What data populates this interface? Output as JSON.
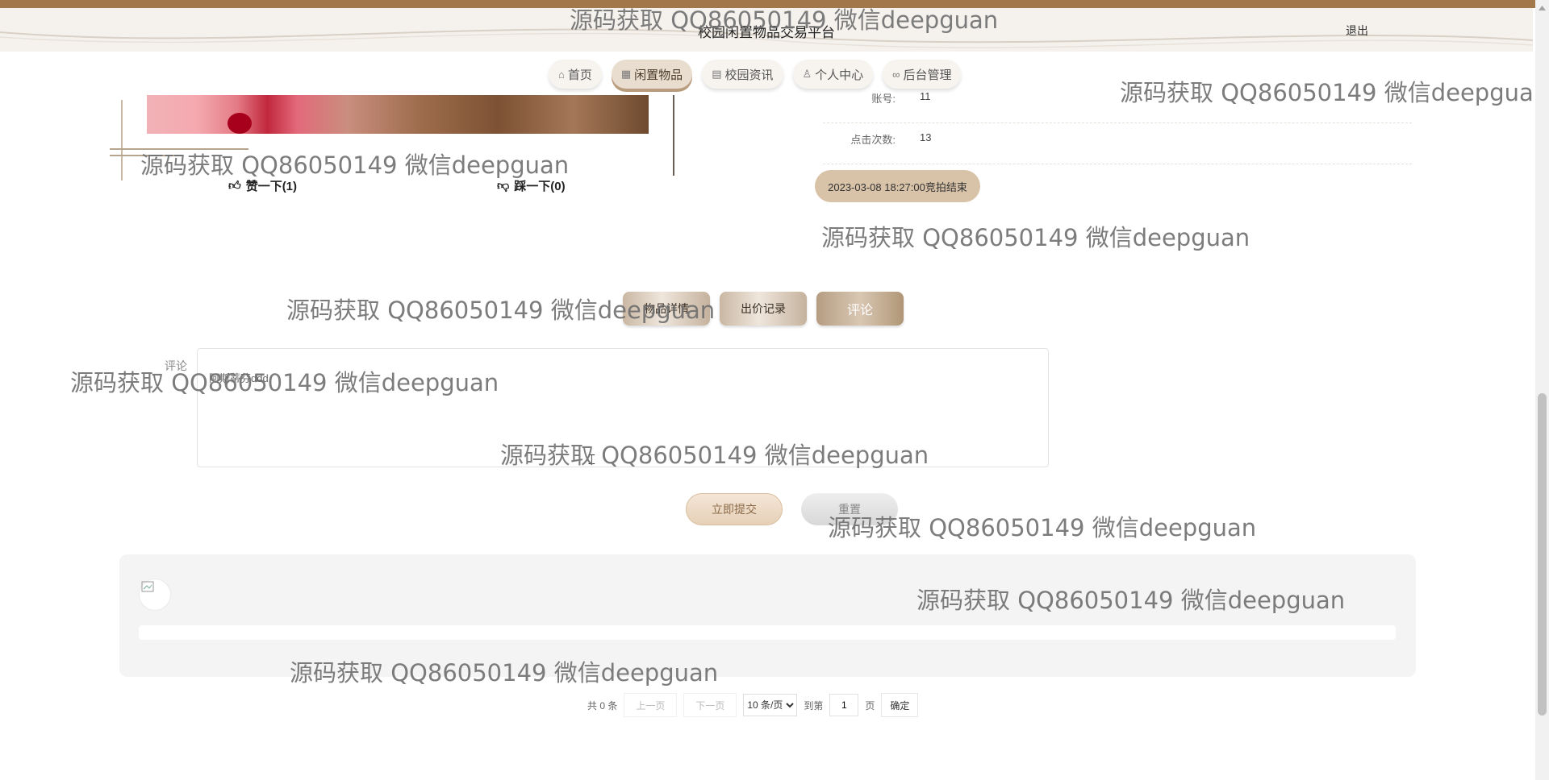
{
  "header": {
    "site_title": "校园闲置物品交易平台",
    "logout": "退出"
  },
  "nav": [
    {
      "label": "首页",
      "icon": "home-icon",
      "glyph": "⌂"
    },
    {
      "label": "闲置物品",
      "icon": "gift-icon",
      "glyph": "▦"
    },
    {
      "label": "校园资讯",
      "icon": "news-icon",
      "glyph": "▤"
    },
    {
      "label": "个人中心",
      "icon": "user-icon",
      "glyph": "♙"
    },
    {
      "label": "后台管理",
      "icon": "link-icon",
      "glyph": "∞"
    }
  ],
  "product": {
    "like_label": "赞一下(1)",
    "dislike_label": "踩一下(0)",
    "info": [
      {
        "label": "账号:",
        "value": "11"
      },
      {
        "label": "点击次数:",
        "value": "13"
      }
    ],
    "auction_end": "2023-03-08 18:27:00竞拍结束"
  },
  "tabs": [
    {
      "label": "物品详情",
      "active": false
    },
    {
      "label": "出价记录",
      "active": false
    },
    {
      "label": "评论",
      "active": true
    }
  ],
  "comment_form": {
    "label": "评论",
    "value": "阿斯蒂芬ddd",
    "submit": "立即提交",
    "reset": "重置"
  },
  "pagination": {
    "total": "共 0 条",
    "prev": "上一页",
    "next": "下一页",
    "page_size": "10 条/页",
    "goto": "到第",
    "page": "1",
    "page_unit": "页",
    "confirm": "确定"
  },
  "watermark": "源码获取 QQ86050149 微信deepguan",
  "colors": {
    "topbar": "#a2784a",
    "accent": "#d8c2a8",
    "panel": "#f4f4f4"
  }
}
